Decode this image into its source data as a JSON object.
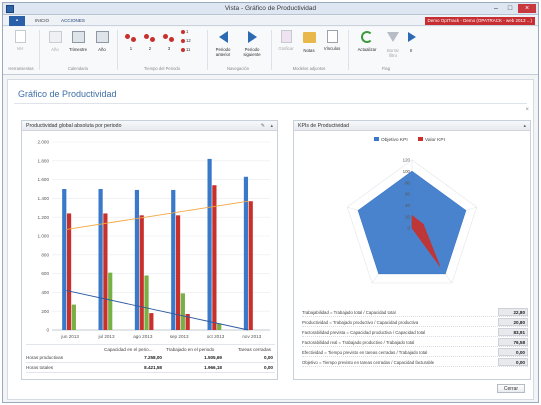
{
  "window": {
    "title": "Vista - Gráfico de Productividad"
  },
  "ribbon": {
    "tabs": [
      "INICIO",
      "ACCIONES"
    ],
    "user_badge": "Demo OptTrack - Demo (OPATRACK - web 2013 ...)",
    "buttons": {
      "ver": "Ver",
      "ano_dim": "Año",
      "trimestre": "Trimestre",
      "ano": "Año",
      "n1": "1",
      "n2": "2",
      "n3": "3",
      "pin_badges": [
        "1",
        "12",
        "11"
      ],
      "periodo_anterior": [
        "Periodo",
        "anterior"
      ],
      "periodo_siguiente": [
        "Periodo",
        "siguiente"
      ],
      "graficar": "Graficar",
      "notas": "Notas",
      "vinculos": "Vínculos",
      "actualizar": "Actualizar",
      "borrar_filtro": [
        "Borrar",
        "filtro"
      ],
      "ir": "Ir"
    },
    "groups": [
      "Herramientas",
      "Calendario",
      "Tiempo del Periodo",
      "Navegación",
      "Modelos adjuntos",
      "Flag"
    ]
  },
  "page": {
    "title": "Gráfico de Productividad",
    "close_glyph": "×"
  },
  "left_panel": {
    "title": "Productividad global absoluta por periodo",
    "table": {
      "headers": [
        "Capacidad en el perio...",
        "Trabajado en el periodo",
        "Tareas cerradas"
      ],
      "rows": [
        {
          "label": "Horas productivas",
          "values": [
            "7.258,00",
            "1.505,69",
            "0,00"
          ]
        },
        {
          "label": "Horas totales",
          "values": [
            "8.421,58",
            "1.966,18",
            "0,00"
          ]
        }
      ]
    }
  },
  "right_panel": {
    "title": "KPIs de Productividad",
    "kpis": [
      {
        "label": "Trabajabilidad = Trabajado total / Capacidad total",
        "value": "22,80"
      },
      {
        "label": "Productividad = Trabajado productivo / Capacidad productiva",
        "value": "20,80"
      },
      {
        "label": "Factorabilidad prevista = Capacidad productiva / Capacidad total",
        "value": "83,91"
      },
      {
        "label": "Factorabilidad real = Trabajado productivo / Trabajado total",
        "value": "76,58"
      },
      {
        "label": "Efectividad = Tiempo previsto en tareas cerradas / Trabajado total",
        "value": "0,00"
      },
      {
        "label": "Objetivo = Tiempo previsto en tareas cerradas / Capacidad facturable",
        "value": "0,00"
      }
    ]
  },
  "footer": {
    "cancel": "Cerrar"
  },
  "colors": {
    "blue": "#3a78c9",
    "red": "#c8302b",
    "green": "#79b046",
    "orange": "#f0a744",
    "navy": "#2c5aa0"
  },
  "chart_data": [
    {
      "type": "bar",
      "title": "Productividad global absoluta por periodo",
      "categories": [
        "jun 2013",
        "jul 2013",
        "ago 2013",
        "sep 2013",
        "oct 2013",
        "nov 2013"
      ],
      "series": [
        {
          "color": "#3a78c9",
          "values": [
            1500,
            1500,
            1490,
            1490,
            1820,
            1630
          ]
        },
        {
          "color": "#c8302b",
          "values": [
            1240,
            1240,
            1220,
            1220,
            1540,
            1370
          ]
        },
        {
          "color": "#79b046",
          "values": [
            270,
            610,
            580,
            390,
            70,
            0
          ]
        },
        {
          "color": "#c8302b",
          "values": [
            0,
            0,
            180,
            170,
            0,
            0
          ]
        }
      ],
      "trendlines": [
        {
          "color": "#f0a744",
          "from": 1070,
          "to": 1370
        },
        {
          "color": "#2c5aa0",
          "from": 420,
          "to": 0
        }
      ],
      "y_ticks": [
        "2.000",
        "1.800",
        "1.600",
        "1.400",
        "1.200",
        "1.000",
        "800",
        "600",
        "400",
        "200",
        "0"
      ],
      "ylim": [
        0,
        2000
      ],
      "grid": true
    },
    {
      "type": "radar",
      "title": "KPIs de Productividad",
      "legend": [
        "Objetivo KPI",
        "Valor KPI"
      ],
      "legend_position": "top",
      "r_ticks": [
        "120",
        "100",
        "80",
        "60",
        "40",
        "20",
        "0"
      ],
      "rlim": [
        0,
        120
      ],
      "series": [
        {
          "name": "Objetivo KPI",
          "color": "#3a78c9",
          "values": [
            100,
            100,
            100,
            100,
            100
          ]
        },
        {
          "name": "Valor KPI",
          "color": "#c8302b",
          "values": [
            22,
            21,
            84,
            0,
            0
          ]
        }
      ]
    }
  ]
}
